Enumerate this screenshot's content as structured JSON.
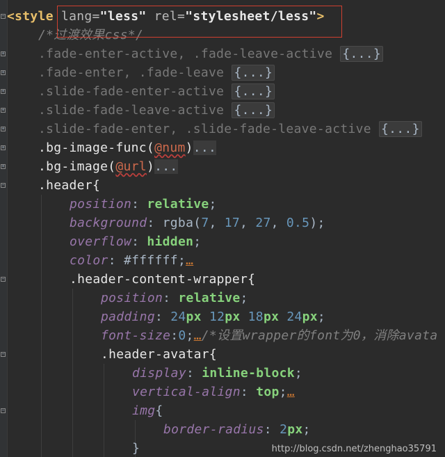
{
  "editor": {
    "lines": [
      {
        "id": "l1",
        "parts": [
          {
            "c": "tag-open",
            "t": "<"
          },
          {
            "c": "tagname",
            "t": "style"
          },
          {
            "c": "plain",
            "t": " "
          },
          {
            "c": "attr",
            "t": "lang="
          },
          {
            "c": "attrval",
            "t": "\"less\""
          },
          {
            "c": "plain",
            "t": " "
          },
          {
            "c": "attr",
            "t": "rel="
          },
          {
            "c": "attrval",
            "t": "\"stylesheet/less\""
          },
          {
            "c": "tag-close",
            "t": ">"
          }
        ]
      },
      {
        "id": "l2",
        "indent": 1,
        "parts": [
          {
            "c": "cm",
            "t": "/*过渡效果css*/"
          }
        ]
      },
      {
        "id": "l3",
        "indent": 1,
        "parts": [
          {
            "c": "sel-faded",
            "t": ".fade-enter-active, .fade-leave-active "
          },
          {
            "c": "folded",
            "t": "{...}"
          }
        ]
      },
      {
        "id": "l4",
        "indent": 1,
        "parts": [
          {
            "c": "sel-faded",
            "t": ".fade-enter, .fade-leave "
          },
          {
            "c": "folded",
            "t": "{...}"
          }
        ]
      },
      {
        "id": "l5",
        "indent": 1,
        "parts": [
          {
            "c": "sel-faded",
            "t": ".slide-fade-enter-active "
          },
          {
            "c": "folded",
            "t": "{...}"
          }
        ]
      },
      {
        "id": "l6",
        "indent": 1,
        "parts": [
          {
            "c": "sel-faded",
            "t": ".slide-fade-leave-active "
          },
          {
            "c": "folded",
            "t": "{...}"
          }
        ]
      },
      {
        "id": "l7",
        "indent": 1,
        "parts": [
          {
            "c": "sel-faded",
            "t": ".slide-fade-enter, .slide-fade-leave-active "
          },
          {
            "c": "folded",
            "t": "{...}"
          }
        ]
      },
      {
        "id": "l8",
        "indent": 1,
        "parts": [
          {
            "c": "selector",
            "t": ".bg-image-func("
          },
          {
            "c": "var",
            "t": "@num"
          },
          {
            "c": "selector",
            "t": ")"
          },
          {
            "c": "dots",
            "t": "..."
          }
        ]
      },
      {
        "id": "l9",
        "indent": 1,
        "parts": [
          {
            "c": "selector",
            "t": ".bg-image("
          },
          {
            "c": "var",
            "t": "@url"
          },
          {
            "c": "selector",
            "t": ")"
          },
          {
            "c": "dots",
            "t": "..."
          }
        ]
      },
      {
        "id": "l10",
        "indent": 1,
        "parts": [
          {
            "c": "selector",
            "t": ".header{"
          }
        ]
      },
      {
        "id": "l11",
        "indent": 2,
        "parts": [
          {
            "c": "prop",
            "t": "position"
          },
          {
            "c": "plain",
            "t": ": "
          },
          {
            "c": "kw",
            "t": "relative"
          },
          {
            "c": "plain",
            "t": ";"
          }
        ]
      },
      {
        "id": "l12",
        "indent": 2,
        "parts": [
          {
            "c": "prop",
            "t": "background"
          },
          {
            "c": "plain",
            "t": ": "
          },
          {
            "c": "func",
            "t": "rgba("
          },
          {
            "c": "num",
            "t": "7"
          },
          {
            "c": "plain",
            "t": ", "
          },
          {
            "c": "num",
            "t": "17"
          },
          {
            "c": "plain",
            "t": ", "
          },
          {
            "c": "num",
            "t": "27"
          },
          {
            "c": "plain",
            "t": ", "
          },
          {
            "c": "num",
            "t": "0.5"
          },
          {
            "c": "plain",
            "t": ");"
          }
        ]
      },
      {
        "id": "l13",
        "indent": 2,
        "parts": [
          {
            "c": "prop",
            "t": "overflow"
          },
          {
            "c": "plain",
            "t": ": "
          },
          {
            "c": "kw",
            "t": "hidden"
          },
          {
            "c": "plain",
            "t": ";"
          }
        ]
      },
      {
        "id": "l14",
        "indent": 2,
        "parts": [
          {
            "c": "prop",
            "t": "color"
          },
          {
            "c": "plain",
            "t": ": "
          },
          {
            "c": "plain",
            "t": "#ffffff"
          },
          {
            "c": "plain",
            "t": ";"
          },
          {
            "c": "ellipsis",
            "t": "…"
          }
        ]
      },
      {
        "id": "l15",
        "indent": 2,
        "parts": [
          {
            "c": "selector",
            "t": ".header-content-wrapper{"
          }
        ]
      },
      {
        "id": "l16",
        "indent": 3,
        "parts": [
          {
            "c": "prop",
            "t": "position"
          },
          {
            "c": "plain",
            "t": ": "
          },
          {
            "c": "kw",
            "t": "relative"
          },
          {
            "c": "plain",
            "t": ";"
          }
        ]
      },
      {
        "id": "l17",
        "indent": 3,
        "parts": [
          {
            "c": "prop",
            "t": "padding"
          },
          {
            "c": "plain",
            "t": ": "
          },
          {
            "c": "num",
            "t": "24"
          },
          {
            "c": "kw",
            "t": "px"
          },
          {
            "c": "plain",
            "t": " "
          },
          {
            "c": "num",
            "t": "12"
          },
          {
            "c": "kw",
            "t": "px"
          },
          {
            "c": "plain",
            "t": " "
          },
          {
            "c": "num",
            "t": "18"
          },
          {
            "c": "kw",
            "t": "px"
          },
          {
            "c": "plain",
            "t": " "
          },
          {
            "c": "num",
            "t": "24"
          },
          {
            "c": "kw",
            "t": "px"
          },
          {
            "c": "plain",
            "t": ";"
          }
        ]
      },
      {
        "id": "l18",
        "indent": 3,
        "parts": [
          {
            "c": "prop",
            "t": "font-size"
          },
          {
            "c": "plain",
            "t": ":"
          },
          {
            "c": "num",
            "t": "0"
          },
          {
            "c": "plain",
            "t": ";"
          },
          {
            "c": "ellipsis",
            "t": "…"
          },
          {
            "c": "cm",
            "t": "/*设置wrapper的font为0，消除avata"
          }
        ]
      },
      {
        "id": "l19",
        "indent": 3,
        "parts": [
          {
            "c": "selector",
            "t": ".header-avatar{"
          }
        ]
      },
      {
        "id": "l20",
        "indent": 4,
        "parts": [
          {
            "c": "prop",
            "t": "display"
          },
          {
            "c": "plain",
            "t": ": "
          },
          {
            "c": "kw",
            "t": "inline-block"
          },
          {
            "c": "plain",
            "t": ";"
          }
        ]
      },
      {
        "id": "l21",
        "indent": 4,
        "parts": [
          {
            "c": "prop",
            "t": "vertical-align"
          },
          {
            "c": "plain",
            "t": ": "
          },
          {
            "c": "kw",
            "t": "top"
          },
          {
            "c": "plain",
            "t": ";"
          },
          {
            "c": "ellipsis",
            "t": "…"
          }
        ]
      },
      {
        "id": "l22",
        "indent": 4,
        "parts": [
          {
            "c": "prop",
            "t": "img"
          },
          {
            "c": "plain",
            "t": "{"
          }
        ]
      },
      {
        "id": "l23",
        "indent": 5,
        "parts": [
          {
            "c": "prop",
            "t": "border-radius"
          },
          {
            "c": "plain",
            "t": ": "
          },
          {
            "c": "num",
            "t": "2"
          },
          {
            "c": "kw",
            "t": "px"
          },
          {
            "c": "plain",
            "t": ";"
          }
        ]
      },
      {
        "id": "l24",
        "indent": 4,
        "parts": [
          {
            "c": "plain",
            "t": "}"
          }
        ]
      }
    ]
  },
  "watermark": "http://blog.csdn.net/zhenghao35791"
}
